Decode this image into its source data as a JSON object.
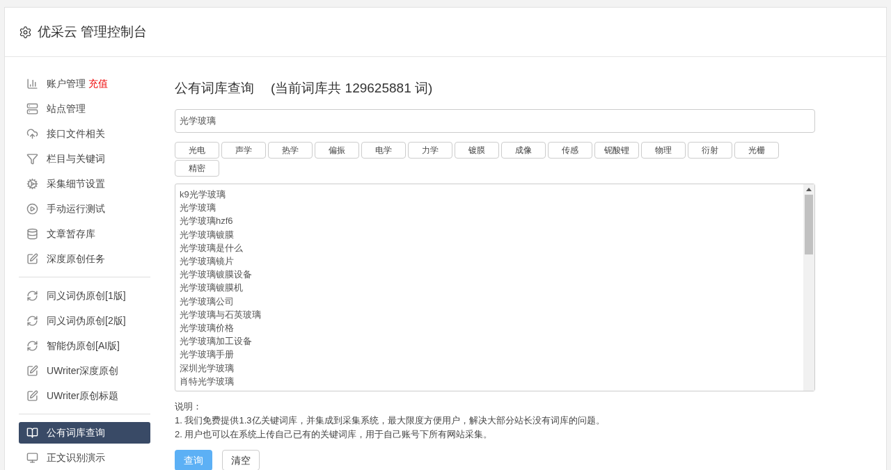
{
  "header": {
    "title": "优采云 管理控制台"
  },
  "sidebar": {
    "groups": [
      {
        "items": [
          {
            "label": "账户管理",
            "badge": "充值",
            "selected": false
          },
          {
            "label": "站点管理",
            "selected": false
          },
          {
            "label": "接口文件相关",
            "selected": false
          },
          {
            "label": "栏目与关键词",
            "selected": false
          },
          {
            "label": "采集细节设置",
            "selected": false
          },
          {
            "label": "手动运行测试",
            "selected": false
          },
          {
            "label": "文章暂存库",
            "selected": false
          },
          {
            "label": "深度原创任务",
            "selected": false
          }
        ]
      },
      {
        "items": [
          {
            "label": "同义词伪原创[1版]",
            "selected": false
          },
          {
            "label": "同义词伪原创[2版]",
            "selected": false
          },
          {
            "label": "智能伪原创[AI版]",
            "selected": false
          },
          {
            "label": "UWriter深度原创",
            "selected": false
          },
          {
            "label": "UWriter原创标题",
            "selected": false
          }
        ]
      },
      {
        "items": [
          {
            "label": "公有词库查询",
            "selected": true
          },
          {
            "label": "正文识别演示",
            "selected": false
          }
        ]
      }
    ]
  },
  "main": {
    "title": "公有词库查询",
    "count_note": "(当前词库共 129625881 词)",
    "search": {
      "value": "光学玻璃"
    },
    "tags": [
      "光电",
      "声学",
      "热学",
      "偏振",
      "电学",
      "力学",
      "镀膜",
      "成像",
      "传感",
      "铌酸锂",
      "物理",
      "衍射",
      "光栅",
      "精密"
    ],
    "results": [
      "k9光学玻璃",
      "光学玻璃",
      "光学玻璃hzf6",
      "光学玻璃镀膜",
      "光学玻璃是什么",
      "光学玻璃镜片",
      "光学玻璃镀膜设备",
      "光学玻璃镀膜机",
      "光学玻璃公司",
      "光学玻璃与石英玻璃",
      "光学玻璃价格",
      "光学玻璃加工设备",
      "光学玻璃手册",
      "深圳光学玻璃",
      "肖特光学玻璃"
    ],
    "notes_title": "说明：",
    "notes": [
      "1. 我们免费提供1.3亿关键词库，并集成到采集系统，最大限度方便用户，解决大部分站长没有词库的问题。",
      "2. 用户也可以在系统上传自己已有的关键词库，用于自己账号下所有网站采集。"
    ],
    "buttons": [
      {
        "label": "查询",
        "kind": "primary"
      },
      {
        "label": "清空",
        "kind": "default"
      }
    ]
  }
}
